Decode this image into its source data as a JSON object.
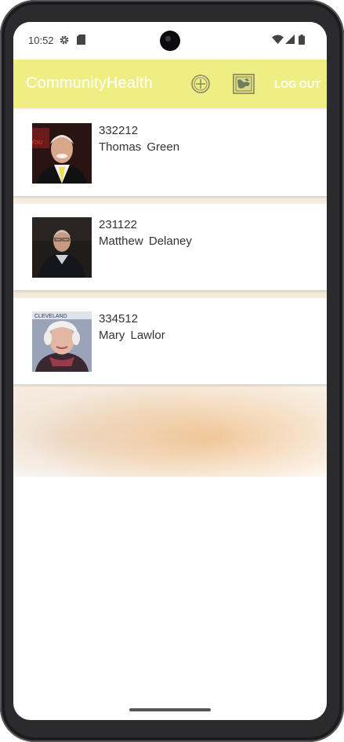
{
  "status_bar": {
    "time": "10:52",
    "left_icons": [
      "settings-gear-icon",
      "sd-card-icon"
    ],
    "right_icons": [
      "wifi-icon",
      "cell-signal-icon",
      "battery-icon"
    ]
  },
  "app_bar": {
    "title": "CommunityHealth",
    "add_icon": "add-circle-icon",
    "map_icon": "map-icon",
    "logout_label": "LOG OUT",
    "color": "#eeee84"
  },
  "patients": [
    {
      "id": "332212",
      "name": "Thomas  Green",
      "photo_icon": "portrait-photo"
    },
    {
      "id": "231122",
      "name": "Matthew  Delaney",
      "photo_icon": "portrait-photo"
    },
    {
      "id": "334512",
      "name": "Mary  Lawlor",
      "photo_icon": "portrait-photo"
    }
  ]
}
